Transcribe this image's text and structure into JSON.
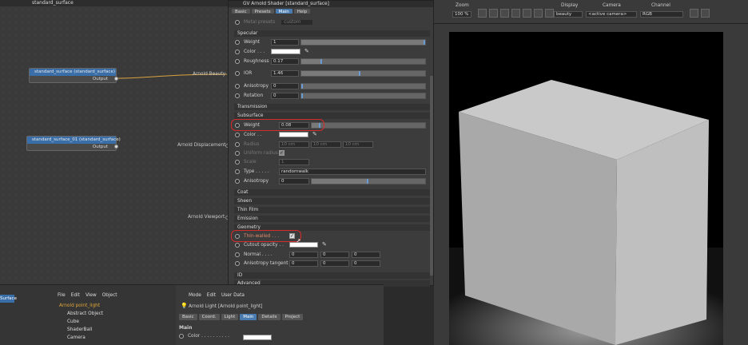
{
  "node_editor": {
    "title": "standard_surface",
    "node1_title": "standard_surface (standard_surface)",
    "node1_output": "Output",
    "node2_title": "standard_surface_01 (standard_surface)",
    "node2_output": "Output",
    "port_beauty": "Arnold Beauty",
    "port_displacement": "Arnold Displacement",
    "port_viewport": "Arnold Viewport"
  },
  "gv_panel": {
    "title": "GV Arnold Shader [standard_surface]",
    "tabs": [
      "Basic",
      "Presets",
      "Main",
      "Help"
    ],
    "metal_presets_label": "Metal presets",
    "metal_presets_value": "custom",
    "specular_header": "Specular",
    "weight_label": "Weight",
    "weight_value": "1",
    "color_label": "Color . . .",
    "roughness_label": "Roughness",
    "roughness_value": "0.17",
    "ior_label": "IOR",
    "ior_value": "1.46",
    "anisotropy_label": "Anisotropy",
    "anisotropy_value": "0",
    "rotation_label": "Rotation",
    "rotation_value": "0",
    "transmission_header": "Transmission",
    "subsurface_header": "Subsurface",
    "ss_weight_label": "Weight",
    "ss_weight_value": "0.08",
    "ss_color_label": "Color . .",
    "radius_label": "Radius",
    "radius_values": [
      "10 cm",
      "10 cm",
      "10 cm"
    ],
    "uniform_radius_label": "Uniform radius",
    "scale_label": "Scale",
    "scale_value": "1",
    "type_label": "Type . . . . .",
    "type_value": "randomwalk",
    "ss_anisotropy_label": "Anisotropy",
    "ss_anisotropy_value": "0",
    "coat_header": "Coat",
    "sheen_header": "Sheen",
    "thin_film_header": "Thin Film",
    "emission_header": "Emission",
    "geometry_header": "Geometry",
    "thin_walled_label": "Thin-walled . . .",
    "cutout_label": "Cutout opacity . .",
    "normal_label": "Normal . . . .",
    "normal_values": [
      "0",
      "0",
      "0"
    ],
    "aniso_tangent_label": "Anisotropy tangent",
    "aniso_tangent_values": [
      "0",
      "0",
      "0"
    ],
    "id_header": "ID",
    "advanced_header": "Advanced"
  },
  "toolbar": {
    "zoom_label": "Zoom",
    "zoom_value": "100 %",
    "display_label": "Display",
    "display_value": "beauty",
    "camera_label": "Camera",
    "camera_value": "<active camera>",
    "channel_label": "Channel",
    "channel_value": "RGB"
  },
  "object_manager": {
    "menu": [
      "File",
      "Edit",
      "View",
      "Object"
    ],
    "items": [
      "Arnold point_light",
      "Abstract Object",
      "Cube",
      "ShaderBall",
      "Camera"
    ],
    "left_label": "Surface"
  },
  "attribute_manager": {
    "menu": [
      "Mode",
      "Edit",
      "User Data"
    ],
    "title": "Arnold Light [Arnold point_light]",
    "tabs": [
      "Basic",
      "Coord.",
      "Light",
      "Main",
      "Details",
      "Project"
    ],
    "section": "Main",
    "color_label": "Color . . . . . . . . . ."
  },
  "colors": {
    "accent": "#4a7bb0",
    "highlight": "#d62b2b",
    "node_header": "#3a6ea8"
  }
}
